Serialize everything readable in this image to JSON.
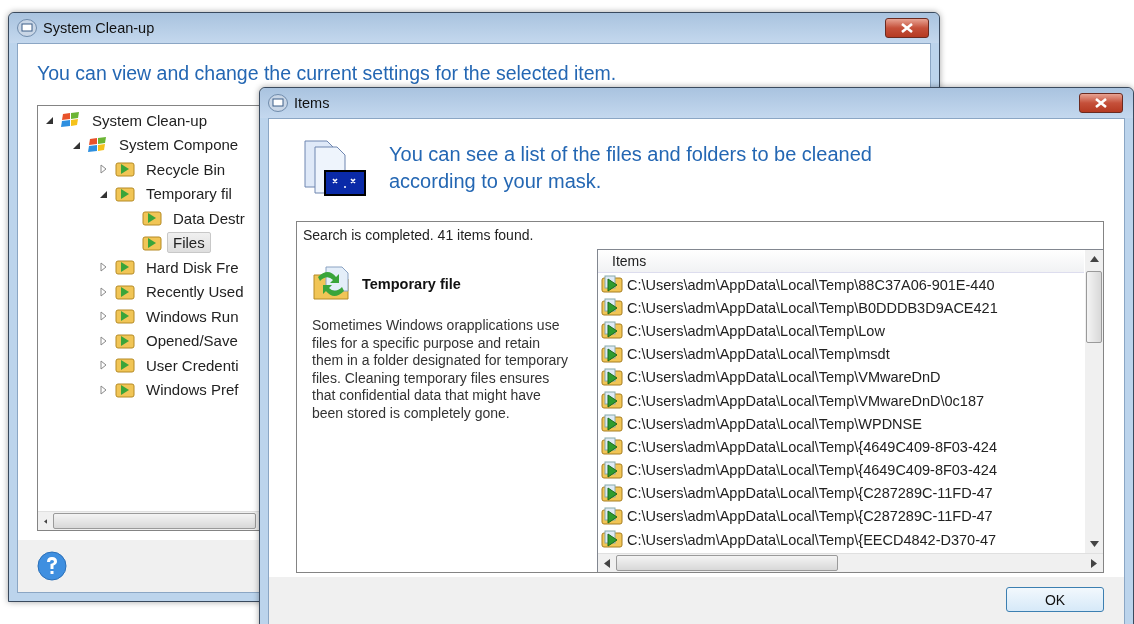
{
  "main_window": {
    "title": "System Clean-up",
    "heading": "You can view and change the current settings for the selected item.",
    "tree": [
      {
        "label": "System Clean-up",
        "expanded": true,
        "selected": false,
        "children": [
          {
            "label": "System Compone",
            "expanded": true,
            "selected": false,
            "children": [
              {
                "label": "Recycle Bin",
                "expanded": false,
                "selected": false
              },
              {
                "label": "Temporary fil",
                "expanded": true,
                "selected": false,
                "children": [
                  {
                    "label": "Data Destr",
                    "selected": false
                  },
                  {
                    "label": "Files",
                    "selected": true
                  }
                ]
              },
              {
                "label": "Hard Disk Fre",
                "expanded": false,
                "selected": false
              },
              {
                "label": "Recently Used",
                "expanded": false,
                "selected": false
              },
              {
                "label": "Windows Run",
                "expanded": false,
                "selected": false
              },
              {
                "label": "Opened/Save",
                "expanded": false,
                "selected": false
              },
              {
                "label": "User Credenti",
                "expanded": false,
                "selected": false
              },
              {
                "label": "Windows Pref",
                "expanded": false,
                "selected": false
              }
            ]
          }
        ]
      }
    ]
  },
  "items_dialog": {
    "title": "Items",
    "heading": "You can see a list of the files and folders to be cleaned according to your mask.",
    "status": "Search is completed. 41 items found.",
    "category": {
      "title": "Temporary file",
      "description": "Sometimes Windows orapplications use files for a specific purpose and retain them in a folder designated for temporary files. Cleaning temporary files ensures that confidential data that might have been stored is completely gone."
    },
    "list": {
      "columns": [
        "Items"
      ],
      "rows": [
        "C:\\Users\\adm\\AppData\\Local\\Temp\\88C37A06-901E-440",
        "C:\\Users\\adm\\AppData\\Local\\Temp\\B0DDDB3D9ACE421",
        "C:\\Users\\adm\\AppData\\Local\\Temp\\Low",
        "C:\\Users\\adm\\AppData\\Local\\Temp\\msdt",
        "C:\\Users\\adm\\AppData\\Local\\Temp\\VMwareDnD",
        "C:\\Users\\adm\\AppData\\Local\\Temp\\VMwareDnD\\0c187",
        "C:\\Users\\adm\\AppData\\Local\\Temp\\WPDNSE",
        "C:\\Users\\adm\\AppData\\Local\\Temp\\{4649C409-8F03-424",
        "C:\\Users\\adm\\AppData\\Local\\Temp\\{4649C409-8F03-424",
        "C:\\Users\\adm\\AppData\\Local\\Temp\\{C287289C-11FD-47",
        "C:\\Users\\adm\\AppData\\Local\\Temp\\{C287289C-11FD-47",
        "C:\\Users\\adm\\AppData\\Local\\Temp\\{EECD4842-D370-47"
      ]
    },
    "buttons": [
      {
        "label": "OK"
      }
    ]
  }
}
